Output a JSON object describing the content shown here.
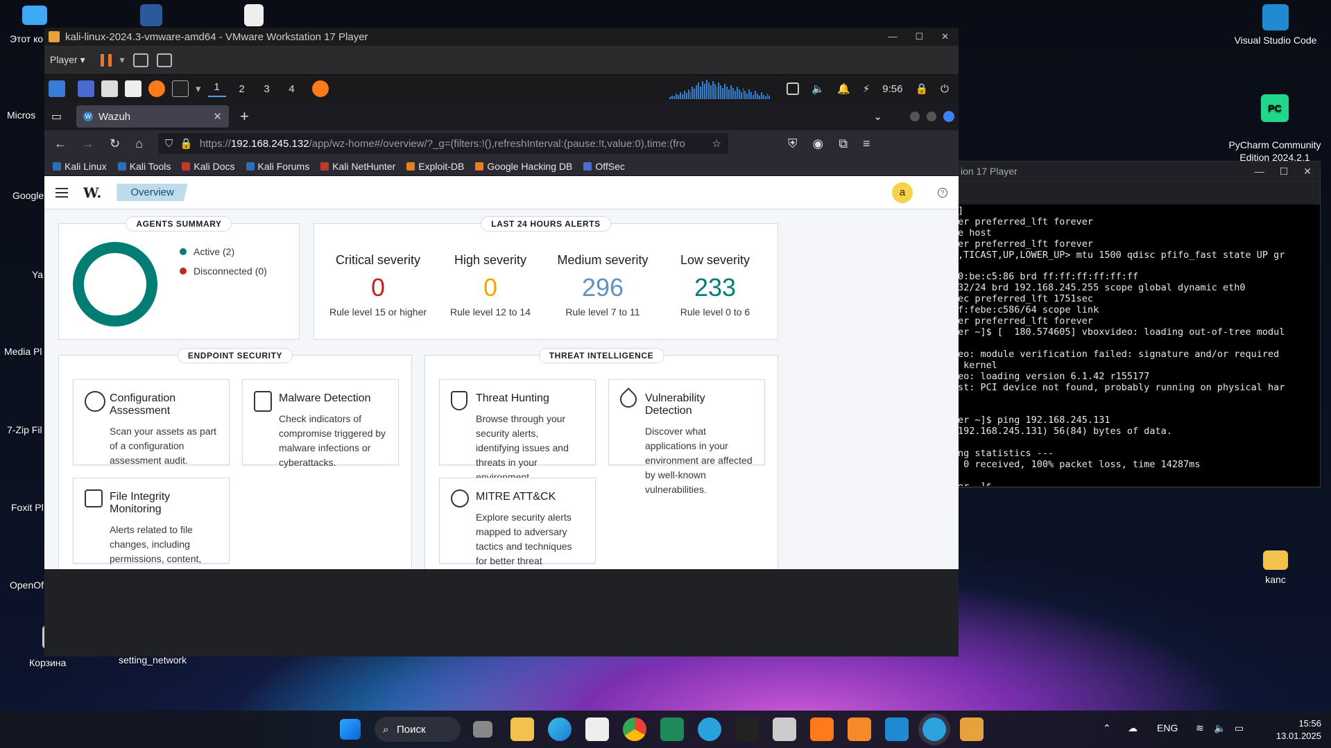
{
  "desktop": {
    "icons": [
      {
        "label": "Этот ко",
        "color": "#3fa9f5"
      },
      {
        "label": "Micros",
        "color": "#2b7cd3"
      },
      {
        "label": "Google",
        "color": "#e94235"
      },
      {
        "label": "Ya",
        "color": "#ff3b30"
      },
      {
        "label": "Media Pl",
        "color": "#555"
      },
      {
        "label": "7-Zip Fil",
        "color": "#444"
      },
      {
        "label": "Foxit Pl",
        "color": "#f06a1a"
      },
      {
        "label": "OpenOf",
        "color": "#2a7fd4"
      },
      {
        "label": "Корзина",
        "color": "#bbb"
      },
      {
        "label": "setting_network",
        "color": "#ddd"
      }
    ],
    "right_icons": [
      {
        "label": "Visual Studio Code"
      },
      {
        "label": "PyCharm Community\nEdition 2024.2.1"
      },
      {
        "label": "kanc"
      }
    ]
  },
  "terminal": {
    "title": "ion 17 Player",
    "lines": [
      "]",
      "er preferred_lft forever",
      "e host",
      "er preferred_lft forever",
      ",TICAST,UP,LOWER_UP> mtu 1500 qdisc pfifo_fast state UP gr",
      "",
      "0:be:c5:86 brd ff:ff:ff:ff:ff:ff",
      "32/24 brd 192.168.245.255 scope global dynamic eth0",
      "ec preferred_lft 1751sec",
      "f:febe:c586/64 scope link",
      "er preferred_lft forever",
      "er ~]$ [  180.574605] vboxvideo: loading out-of-tree modul",
      "",
      "eo: module verification failed: signature and/or required",
      " kernel",
      "eo: loading version 6.1.42 r155177",
      "st: PCI device not found, probably running on physical har",
      "",
      "",
      "er ~]$ ping 192.168.245.131",
      "192.168.245.131) 56(84) bytes of data.",
      "",
      "ng statistics ---",
      " 0 received, 100% packet loss, time 14287ms",
      "",
      "er ~]$"
    ]
  },
  "vmware": {
    "title": "kali-linux-2024.3-vmware-amd64 - VMware Workstation 17 Player",
    "player_menu": "Player"
  },
  "kali": {
    "workspaces": [
      "1",
      "2",
      "3",
      "4"
    ],
    "time": "9:56"
  },
  "firefox": {
    "tab_title": "Wazuh",
    "url_prefix": "https://",
    "url_host": "192.168.245.132",
    "url_rest": "/app/wz-home#/overview/?_g=(filters:!(),refreshInterval:(pause:!t,value:0),time:(fro",
    "bookmarks": [
      {
        "label": "Kali Linux",
        "color": "#2c6fb5"
      },
      {
        "label": "Kali Tools",
        "color": "#2c6fb5"
      },
      {
        "label": "Kali Docs",
        "color": "#c0392b"
      },
      {
        "label": "Kali Forums",
        "color": "#2c6fb5"
      },
      {
        "label": "Kali NetHunter",
        "color": "#c0392b"
      },
      {
        "label": "Exploit-DB",
        "color": "#e67e22"
      },
      {
        "label": "Google Hacking DB",
        "color": "#e67e22"
      },
      {
        "label": "OffSec",
        "color": "#4a6fd6"
      }
    ]
  },
  "wazuh": {
    "logo": "W.",
    "breadcrumb": "Overview",
    "avatar": "a",
    "agents": {
      "title": "AGENTS SUMMARY",
      "active": "Active (2)",
      "disconnected": "Disconnected (0)",
      "active_color": "#017d73",
      "disconnected_color": "#bd271e"
    },
    "alerts": {
      "title": "LAST 24 HOURS ALERTS",
      "items": [
        {
          "title": "Critical severity",
          "value": "0",
          "sub": "Rule level 15 or higher",
          "color": "#bd271e"
        },
        {
          "title": "High severity",
          "value": "0",
          "sub": "Rule level 12 to 14",
          "color": "#f5a700"
        },
        {
          "title": "Medium severity",
          "value": "296",
          "sub": "Rule level 7 to 11",
          "color": "#6092c0"
        },
        {
          "title": "Low severity",
          "value": "233",
          "sub": "Rule level 0 to 6",
          "color": "#017d73"
        }
      ]
    },
    "endpoint": {
      "title": "ENDPOINT SECURITY",
      "cards": [
        {
          "title": "Configuration Assessment",
          "desc": "Scan your assets as part of a configuration assessment audit."
        },
        {
          "title": "Malware Detection",
          "desc": "Check indicators of compromise triggered by malware infections or cyberattacks."
        },
        {
          "title": "File Integrity Monitoring",
          "desc": "Alerts related to file changes, including permissions, content, ownership, and attributes."
        }
      ]
    },
    "threat": {
      "title": "THREAT INTELLIGENCE",
      "cards": [
        {
          "title": "Threat Hunting",
          "desc": "Browse through your security alerts, identifying issues and threats in your environment."
        },
        {
          "title": "Vulnerability Detection",
          "desc": "Discover what applications in your environment are affected by well-known vulnerabilities."
        },
        {
          "title": "MITRE ATT&CK",
          "desc": "Explore security alerts mapped to adversary tactics and techniques for better threat understanding."
        }
      ]
    }
  },
  "taskbar": {
    "search": "Поиск",
    "lang": "ENG",
    "time": "15:56",
    "date": "13.01.2025"
  }
}
